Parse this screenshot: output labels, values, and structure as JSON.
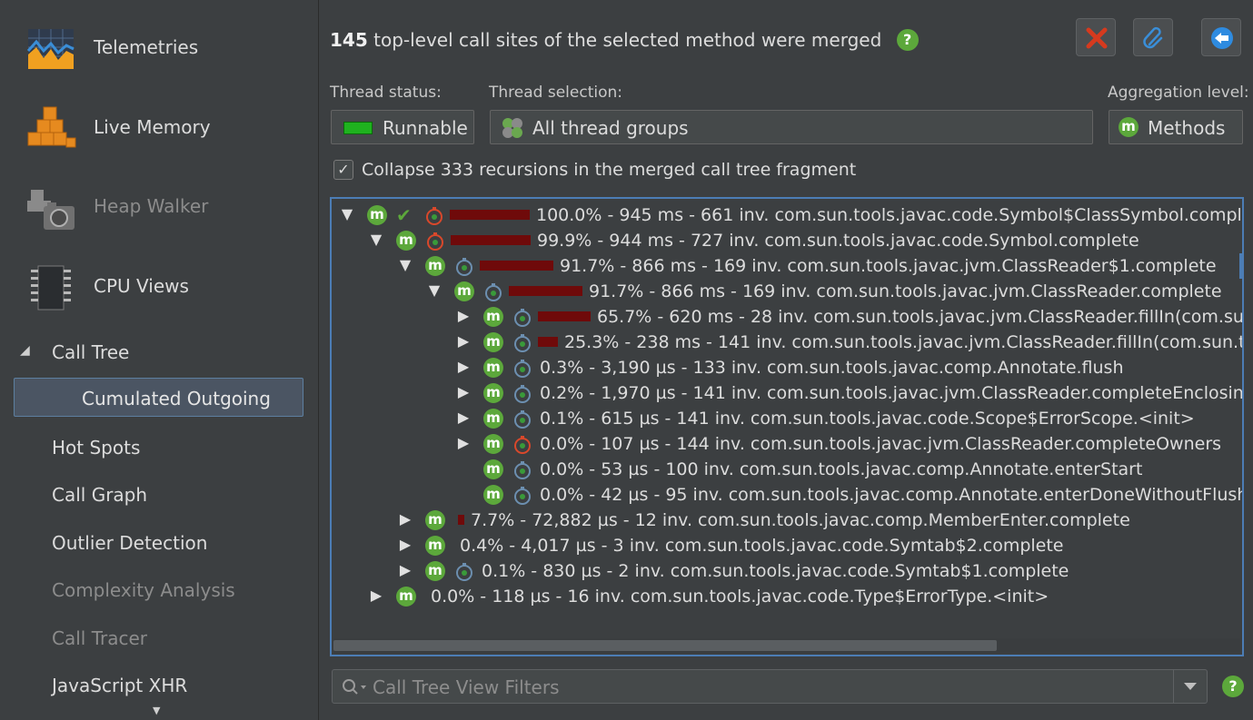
{
  "sidebar": {
    "big_items": [
      {
        "label": "Telemetries",
        "icon": "telemetries-icon",
        "enabled": true
      },
      {
        "label": "Live Memory",
        "icon": "live-memory-icon",
        "enabled": true
      },
      {
        "label": "Heap Walker",
        "icon": "heap-walker-icon",
        "enabled": false
      },
      {
        "label": "CPU Views",
        "icon": "cpu-views-icon",
        "enabled": true
      }
    ],
    "section": {
      "label": "Call Tree",
      "expanded": true
    },
    "selected": "Cumulated Outgoing",
    "sub_items": [
      {
        "label": "Hot Spots",
        "enabled": true
      },
      {
        "label": "Call Graph",
        "enabled": true
      },
      {
        "label": "Outlier Detection",
        "enabled": true
      },
      {
        "label": "Complexity Analysis",
        "enabled": false
      },
      {
        "label": "Call Tracer",
        "enabled": false
      },
      {
        "label": "JavaScript XHR",
        "enabled": true
      }
    ]
  },
  "header": {
    "count": "145",
    "text": "top-level call sites of the selected method were merged",
    "help": "?"
  },
  "toolbar": {
    "buttons": [
      {
        "name": "close-merge-button",
        "icon": "red-x-icon"
      },
      {
        "name": "attach-button",
        "icon": "paperclip-icon"
      },
      {
        "name": "back-button",
        "icon": "back-arrow-icon"
      }
    ]
  },
  "filters": {
    "thread_status_label": "Thread status:",
    "thread_status_value": "Runnable",
    "thread_selection_label": "Thread selection:",
    "thread_selection_value": "All thread groups",
    "aggregation_label": "Aggregation level:",
    "aggregation_value": "Methods",
    "method_badge": "m"
  },
  "collapse": {
    "checked": true,
    "label": "Collapse 333 recursions in the merged call tree fragment"
  },
  "tree": {
    "rows": [
      {
        "depth": 0,
        "arrow": "down",
        "check": true,
        "clock": "red",
        "bar": 1.0,
        "pct": "100.0%",
        "time": "945 ms",
        "inv": "661 inv.",
        "method": "com.sun.tools.javac.code.Symbol$ClassSymbol.complete"
      },
      {
        "depth": 1,
        "arrow": "down",
        "check": false,
        "clock": "red",
        "bar": 0.999,
        "pct": "99.9%",
        "time": "944 ms",
        "inv": "727 inv.",
        "method": "com.sun.tools.javac.code.Symbol.complete"
      },
      {
        "depth": 2,
        "arrow": "down",
        "check": false,
        "clock": "blue",
        "bar": 0.917,
        "pct": "91.7%",
        "time": "866 ms",
        "inv": "169 inv.",
        "method": "com.sun.tools.javac.jvm.ClassReader$1.complete"
      },
      {
        "depth": 3,
        "arrow": "down",
        "check": false,
        "clock": "blue",
        "bar": 0.917,
        "pct": "91.7%",
        "time": "866 ms",
        "inv": "169 inv.",
        "method": "com.sun.tools.javac.jvm.ClassReader.complete"
      },
      {
        "depth": 4,
        "arrow": "right",
        "check": false,
        "clock": "blue",
        "bar": 0.657,
        "pct": "65.7%",
        "time": "620 ms",
        "inv": "28 inv.",
        "method": "com.sun.tools.javac.jvm.ClassReader.fillIn(com.sun.tools.javac.code.Symbol$ClassSymbol)"
      },
      {
        "depth": 4,
        "arrow": "right",
        "check": false,
        "clock": "blue",
        "bar": 0.253,
        "pct": "25.3%",
        "time": "238 ms",
        "inv": "141 inv.",
        "method": "com.sun.tools.javac.jvm.ClassReader.fillIn(com.sun.tools.javac.code.Symbol$PackageSymbol)"
      },
      {
        "depth": 4,
        "arrow": "right",
        "check": false,
        "clock": "blue",
        "bar": 0,
        "pct": "0.3%",
        "time": "3,190 µs",
        "inv": "133 inv.",
        "method": "com.sun.tools.javac.comp.Annotate.flush"
      },
      {
        "depth": 4,
        "arrow": "right",
        "check": false,
        "clock": "blue",
        "bar": 0,
        "pct": "0.2%",
        "time": "1,970 µs",
        "inv": "141 inv.",
        "method": "com.sun.tools.javac.jvm.ClassReader.completeEnclosing"
      },
      {
        "depth": 4,
        "arrow": "right",
        "check": false,
        "clock": "blue",
        "bar": 0,
        "pct": "0.1%",
        "time": "615 µs",
        "inv": "141 inv.",
        "method": "com.sun.tools.javac.code.Scope$ErrorScope.<init>"
      },
      {
        "depth": 4,
        "arrow": "right",
        "check": false,
        "clock": "red",
        "bar": 0,
        "pct": "0.0%",
        "time": "107 µs",
        "inv": "144 inv.",
        "method": "com.sun.tools.javac.jvm.ClassReader.completeOwners"
      },
      {
        "depth": 4,
        "arrow": "none",
        "check": false,
        "clock": "blue",
        "bar": 0,
        "pct": "0.0%",
        "time": "53 µs",
        "inv": "100 inv.",
        "method": "com.sun.tools.javac.comp.Annotate.enterStart"
      },
      {
        "depth": 4,
        "arrow": "none",
        "check": false,
        "clock": "blue",
        "bar": 0,
        "pct": "0.0%",
        "time": "42 µs",
        "inv": "95 inv.",
        "method": "com.sun.tools.javac.comp.Annotate.enterDoneWithoutFlush"
      },
      {
        "depth": 2,
        "arrow": "right",
        "check": false,
        "clock": "none",
        "bar": 0.077,
        "pct": "7.7%",
        "time": "72,882 µs",
        "inv": "12 inv.",
        "method": "com.sun.tools.javac.comp.MemberEnter.complete"
      },
      {
        "depth": 2,
        "arrow": "right",
        "check": false,
        "clock": "none",
        "bar": 0,
        "pct": "0.4%",
        "time": "4,017 µs",
        "inv": "3 inv.",
        "method": "com.sun.tools.javac.code.Symtab$2.complete"
      },
      {
        "depth": 2,
        "arrow": "right",
        "check": false,
        "clock": "blue",
        "bar": 0,
        "pct": "0.1%",
        "time": "830 µs",
        "inv": "2 inv.",
        "method": "com.sun.tools.javac.code.Symtab$1.complete"
      },
      {
        "depth": 1,
        "arrow": "right",
        "check": false,
        "clock": "none",
        "bar": 0,
        "pct": "0.0%",
        "time": "118 µs",
        "inv": "16 inv.",
        "method": "com.sun.tools.javac.code.Type$ErrorType.<init>"
      }
    ]
  },
  "search": {
    "placeholder": "Call Tree View Filters",
    "help": "?"
  }
}
